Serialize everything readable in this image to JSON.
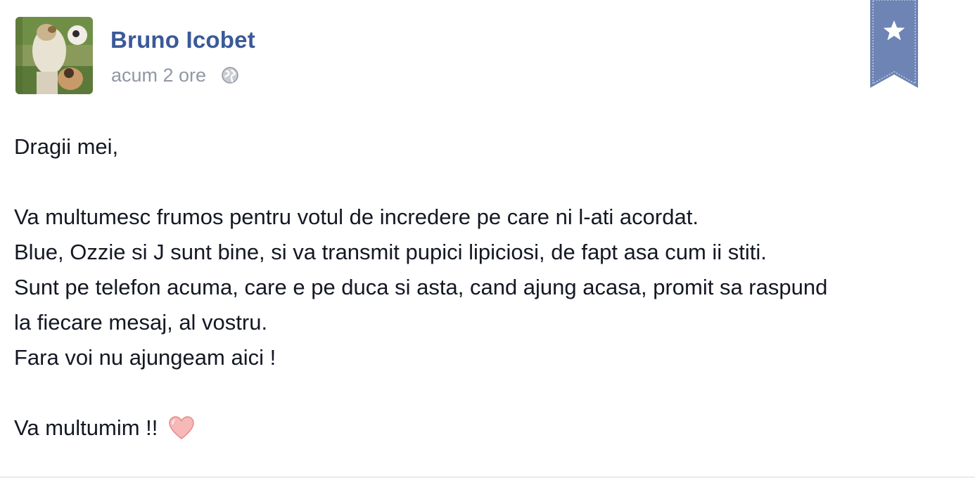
{
  "post": {
    "author": "Bruno Icobet",
    "timestamp": "acum 2 ore",
    "audience_icon": "globe-icon",
    "bookmark_icon": "star-icon",
    "accent_color": "#3b5998",
    "bookmark_color": "#6d84b4",
    "heart_color": "#f29a9a",
    "greeting": "Dragii mei,",
    "body_lines": [
      "Va multumesc frumos pentru votul de incredere pe care ni l-ati acordat.",
      "Blue, Ozzie si J sunt bine, si va transmit pupici lipiciosi, de fapt asa cum ii stiti.",
      "Sunt pe telefon acuma, care e pe duca si asta, cand ajung acasa, promit sa raspund",
      "la fiecare mesaj, al vostru.",
      "Fara voi nu ajungeam aici !"
    ],
    "closing": "Va multumim !!",
    "closing_icon": "heart-icon"
  }
}
